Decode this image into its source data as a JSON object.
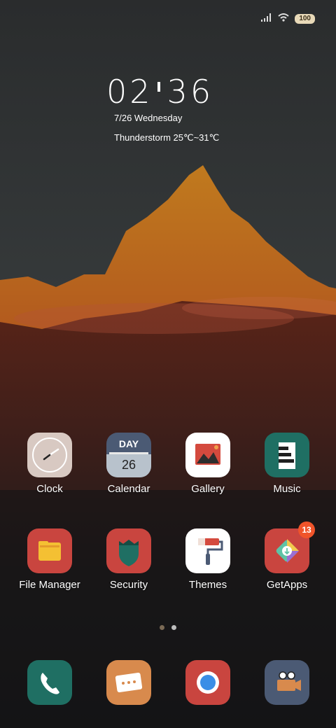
{
  "status_bar": {
    "signal_icon": "signal-icon",
    "wifi_icon": "wifi-icon",
    "battery_level": "100"
  },
  "lockclock": {
    "hour": "02",
    "minute": "36",
    "date": "7/26 Wednesday",
    "weather": "Thunderstorm 25℃~31℃"
  },
  "apps": [
    {
      "label": "Clock",
      "icon": "clock-icon",
      "color": "#d8c9c2"
    },
    {
      "label": "Calendar",
      "icon": "calendar-icon",
      "color": "#4b5a74",
      "month_text": "DAY",
      "day_text": "26"
    },
    {
      "label": "Gallery",
      "icon": "gallery-icon",
      "color": "#ffffff"
    },
    {
      "label": "Music",
      "icon": "music-icon",
      "color": "#1f6f63"
    },
    {
      "label": "File Manager",
      "icon": "folder-icon",
      "color": "#c9453f"
    },
    {
      "label": "Security",
      "icon": "shield-icon",
      "color": "#c9453f"
    },
    {
      "label": "Themes",
      "icon": "paint-roller-icon",
      "color": "#ffffff"
    },
    {
      "label": "GetApps",
      "icon": "getapps-icon",
      "color": "#c9453f",
      "badge": "13"
    }
  ],
  "page_indicator": {
    "pages": 2,
    "active": 1
  },
  "dock": [
    {
      "icon": "phone-icon",
      "color": "#1f6f63"
    },
    {
      "icon": "messages-icon",
      "color": "#d88a4d"
    },
    {
      "icon": "browser-icon",
      "color": "#c9453f"
    },
    {
      "icon": "camera-icon",
      "color": "#4b5a74"
    }
  ]
}
